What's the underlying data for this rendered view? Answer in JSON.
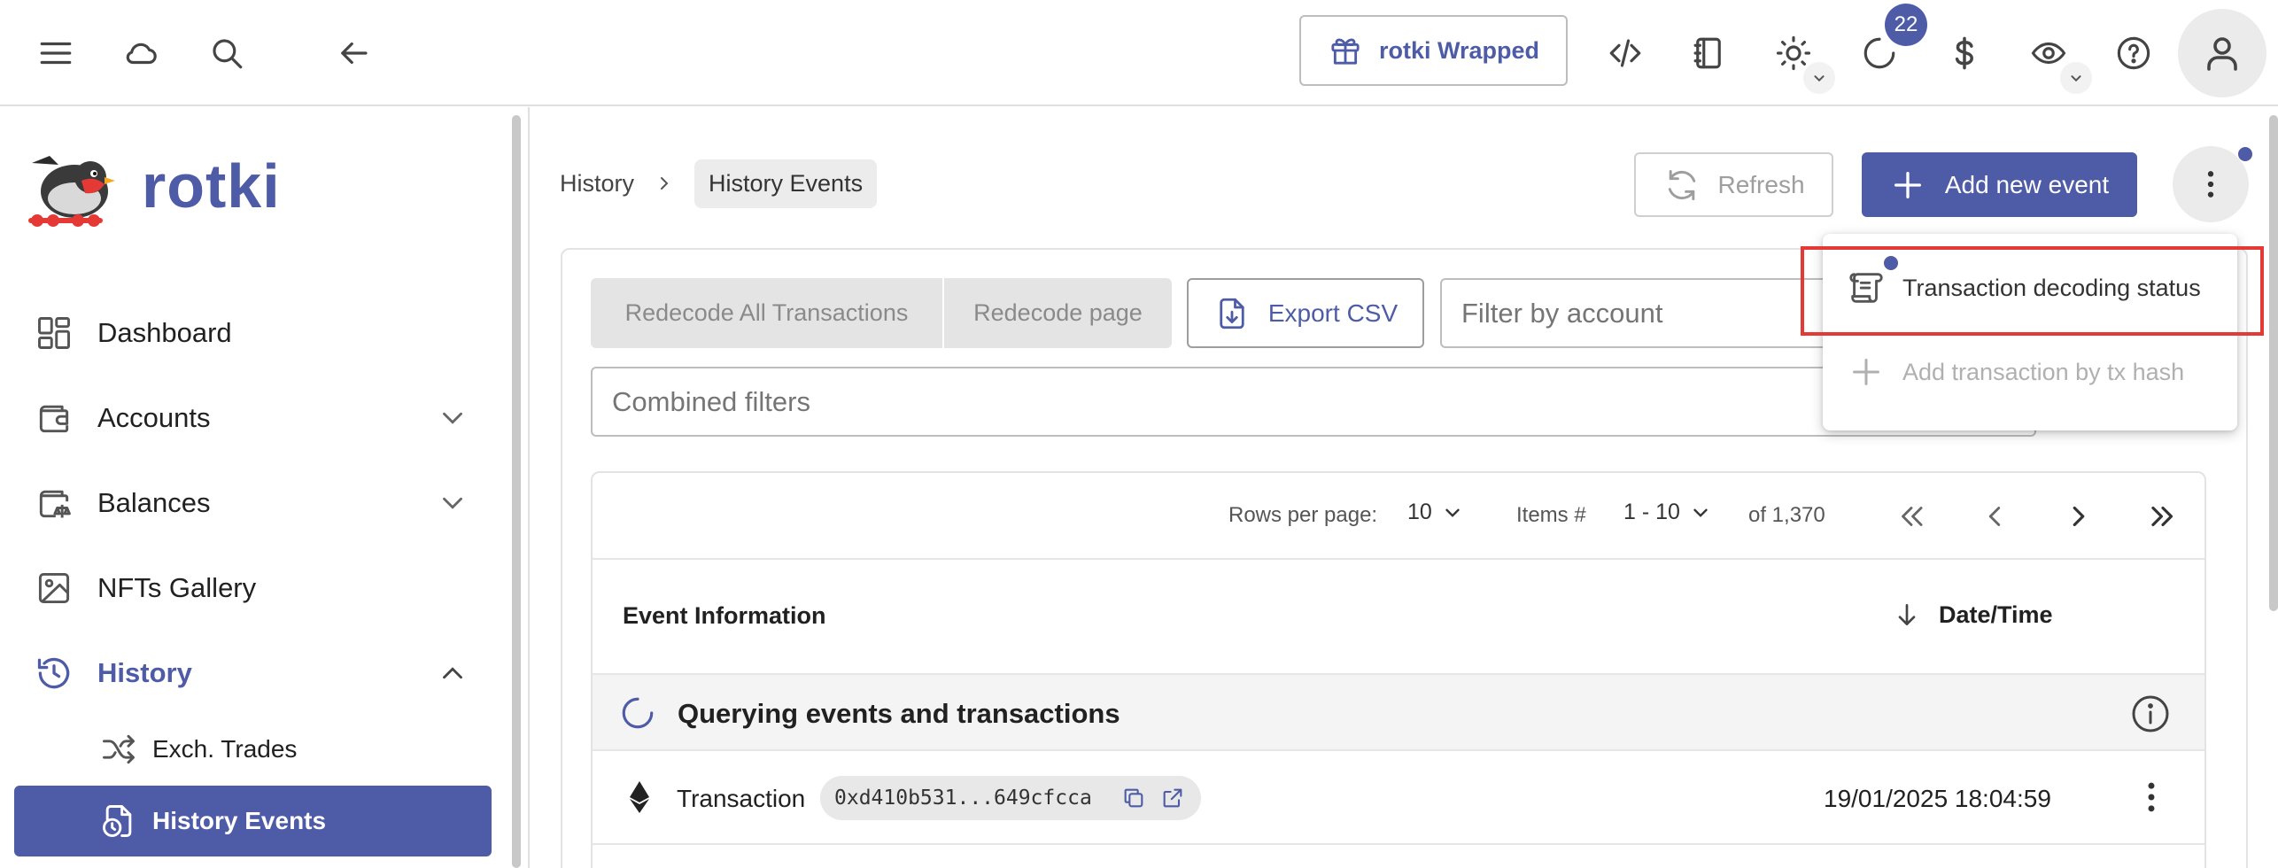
{
  "appbar": {
    "wrapped_label": "rotki Wrapped",
    "notification_count": "22",
    "icons": [
      "menu-icon",
      "cloud-icon",
      "search-icon",
      "back-arrow-icon",
      "gift-icon",
      "code-icon",
      "notes-icon",
      "theme-icon",
      "progress-icon",
      "currency-icon",
      "eye-icon",
      "help-icon",
      "user-icon"
    ]
  },
  "sidebar": {
    "logo_text": "rotki",
    "items": [
      {
        "label": "Dashboard",
        "icon": "dashboard-icon"
      },
      {
        "label": "Accounts",
        "icon": "wallet-icon"
      },
      {
        "label": "Balances",
        "icon": "balances-icon"
      },
      {
        "label": "NFTs Gallery",
        "icon": "image-icon"
      },
      {
        "label": "History",
        "icon": "history-icon"
      }
    ],
    "sub_items": [
      {
        "label": "Exch. Trades",
        "icon": "shuffle-icon"
      },
      {
        "label": "History Events",
        "icon": "history-events-icon"
      }
    ]
  },
  "breadcrumb": {
    "parent": "History",
    "current": "History Events"
  },
  "toolbar": {
    "refresh_label": "Refresh",
    "add_label": "Add new event"
  },
  "filters": {
    "redecode_all": "Redecode All Transactions",
    "redecode_page": "Redecode page",
    "export_csv": "Export CSV",
    "account_placeholder": "Filter by account",
    "combined_placeholder": "Combined filters"
  },
  "pagination": {
    "rows_label": "Rows per page:",
    "rows_value": "10",
    "items_label": "Items #",
    "items_value": "1 - 10",
    "total": "of 1,370"
  },
  "table": {
    "col_event": "Event Information",
    "col_date": "Date/Time",
    "querying_label": "Querying events and transactions",
    "rows": [
      {
        "type": "Transaction",
        "hash": "0xd410b531...649cfcca",
        "date": "19/01/2025 18:04:59"
      }
    ]
  },
  "menu": {
    "items": [
      {
        "label": "Transaction decoding status",
        "icon": "scroll-icon",
        "disabled": false
      },
      {
        "label": "Add transaction by tx hash",
        "icon": "plus-icon",
        "disabled": true
      }
    ]
  },
  "colors": {
    "brand": "#4e5ba6",
    "highlight": "#e53935"
  }
}
